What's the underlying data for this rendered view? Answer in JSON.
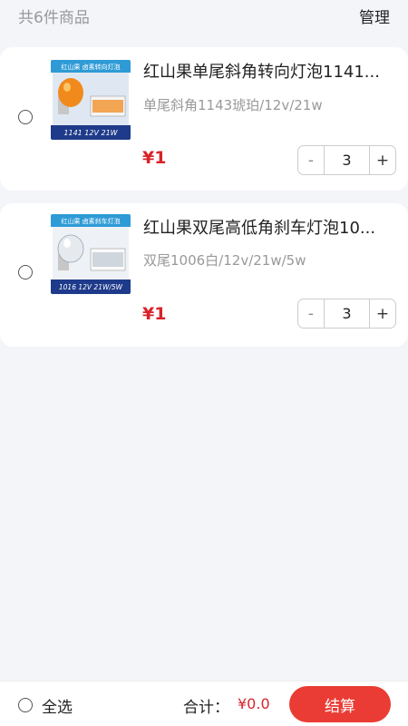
{
  "header": {
    "count_label": "共6件商品",
    "manage_label": "管理"
  },
  "items": [
    {
      "title": "红山果单尾斜角转向灯泡1141...",
      "spec": "单尾斜角1143琥珀/12v/21w",
      "price": "¥1",
      "quantity": "3",
      "minus_label": "-",
      "plus_label": "+",
      "thumb_banner": "红山果 卤素转向灯泡",
      "thumb_caption": "1141 12V 21W",
      "bulb_color": "#f08a1c"
    },
    {
      "title": "红山果双尾高低角刹车灯泡10...",
      "spec": "双尾1006白/12v/21w/5w",
      "price": "¥1",
      "quantity": "3",
      "minus_label": "-",
      "plus_label": "+",
      "thumb_banner": "红山果 卤素刹车灯泡",
      "thumb_caption": "1016 12V 21W/5W",
      "bulb_color": "#e6e9ee"
    }
  ],
  "footer": {
    "select_all_label": "全选",
    "total_label": "合计：",
    "total_value": "¥0.0",
    "checkout_label": "结算"
  },
  "colors": {
    "accent": "#ea3c34",
    "price": "#d8232a",
    "page_bg": "#f3f5f9"
  }
}
